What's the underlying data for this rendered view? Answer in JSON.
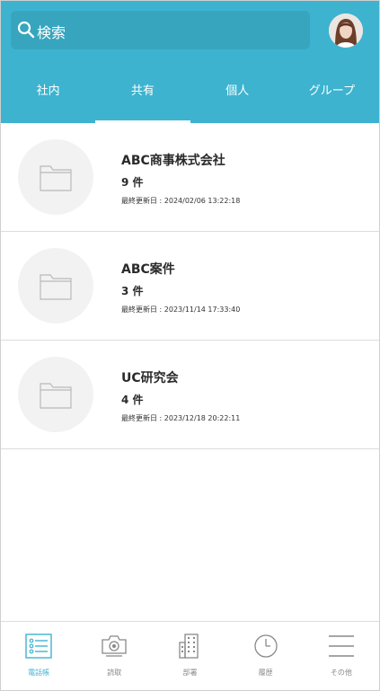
{
  "search": {
    "placeholder": "検索"
  },
  "tabs": [
    {
      "label": "社内"
    },
    {
      "label": "共有",
      "active": true
    },
    {
      "label": "個人"
    },
    {
      "label": "グループ"
    }
  ],
  "folders": [
    {
      "name": "ABC商事株式会社",
      "count": "9 件",
      "updated": "最終更新日 : 2024/02/06 13:22:18"
    },
    {
      "name": "ABC案件",
      "count": "3 件",
      "updated": "最終更新日 : 2023/11/14 17:33:40"
    },
    {
      "name": "UC研究会",
      "count": "4 件",
      "updated": "最終更新日 : 2023/12/18 20:22:11"
    }
  ],
  "bottom_nav": [
    {
      "label": "電話帳",
      "icon": "phonebook-icon",
      "active": true
    },
    {
      "label": "読取",
      "icon": "camera-icon"
    },
    {
      "label": "部署",
      "icon": "building-icon"
    },
    {
      "label": "履歴",
      "icon": "clock-icon"
    },
    {
      "label": "その他",
      "icon": "menu-icon"
    }
  ],
  "colors": {
    "header": "#3db3cf",
    "active_nav": "#3db3cf",
    "divider": "#dcdcdc"
  }
}
